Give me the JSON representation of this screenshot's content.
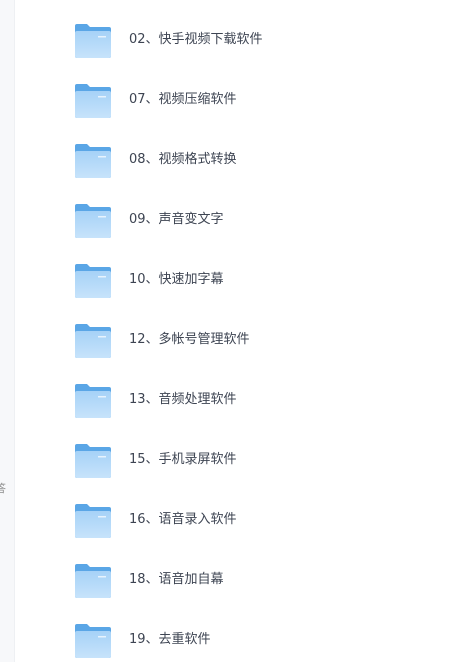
{
  "sidebar": {
    "clipped_text": "答"
  },
  "colors": {
    "folder_back": "#5aa6e6",
    "folder_front_top": "#a6d2f7",
    "folder_front_bottom": "#c7e3fb",
    "text": "#3d4452"
  },
  "folders": [
    {
      "name": "02、快手视频下载软件",
      "icon": "folder-icon"
    },
    {
      "name": "07、视频压缩软件",
      "icon": "folder-icon"
    },
    {
      "name": "08、视频格式转换",
      "icon": "folder-icon"
    },
    {
      "name": "09、声音变文字",
      "icon": "folder-icon"
    },
    {
      "name": "10、快速加字幕",
      "icon": "folder-icon"
    },
    {
      "name": "12、多帐号管理软件",
      "icon": "folder-icon"
    },
    {
      "name": "13、音频处理软件",
      "icon": "folder-icon"
    },
    {
      "name": "15、手机录屏软件",
      "icon": "folder-icon"
    },
    {
      "name": "16、语音录入软件",
      "icon": "folder-icon"
    },
    {
      "name": "18、语音加自幕",
      "icon": "folder-icon"
    },
    {
      "name": "19、去重软件",
      "icon": "folder-icon"
    }
  ]
}
